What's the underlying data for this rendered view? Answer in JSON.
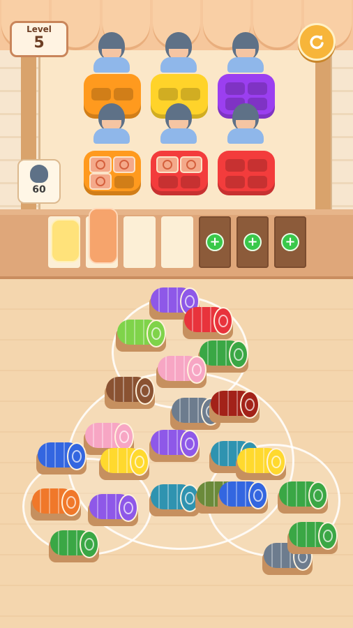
{
  "hud": {
    "level_label": "Level",
    "level_number": "5",
    "restart_icon": "restart-icon"
  },
  "queue": {
    "count": "60"
  },
  "customers": [
    {
      "tray_color": "#ff9a1e",
      "row": "back"
    },
    {
      "tray_color": "#ffd32a",
      "row": "back"
    },
    {
      "tray_color": "#9b3ff0",
      "row": "back"
    },
    {
      "tray_color": "#ff9a1e",
      "row": "front",
      "filled": 3
    },
    {
      "tray_color": "#f33c3c",
      "row": "front",
      "filled": 2
    },
    {
      "tray_color": "#f33c3c",
      "row": "front",
      "filled": 0
    }
  ],
  "counter_slots": [
    {
      "state": "filled",
      "roll_color": "#ffe27a"
    },
    {
      "state": "filled",
      "roll_color": "#f6a46c"
    },
    {
      "state": "empty"
    },
    {
      "state": "empty"
    },
    {
      "state": "locked",
      "icon": "plus-icon"
    },
    {
      "state": "locked",
      "icon": "plus-icon"
    },
    {
      "state": "locked",
      "icon": "plus-icon"
    }
  ],
  "colors": {
    "purple": "#8e58e8",
    "red": "#e8333c",
    "green": "#7fd34a",
    "dark_green": "#3aa745",
    "pink": "#f7a6c4",
    "brown": "#8a5232",
    "dark_red": "#a32219",
    "blue": "#3366e0",
    "yellow": "#ffd92e",
    "orange": "#f0782a",
    "teal": "#2f93b0",
    "slate": "#6d7c8e"
  }
}
